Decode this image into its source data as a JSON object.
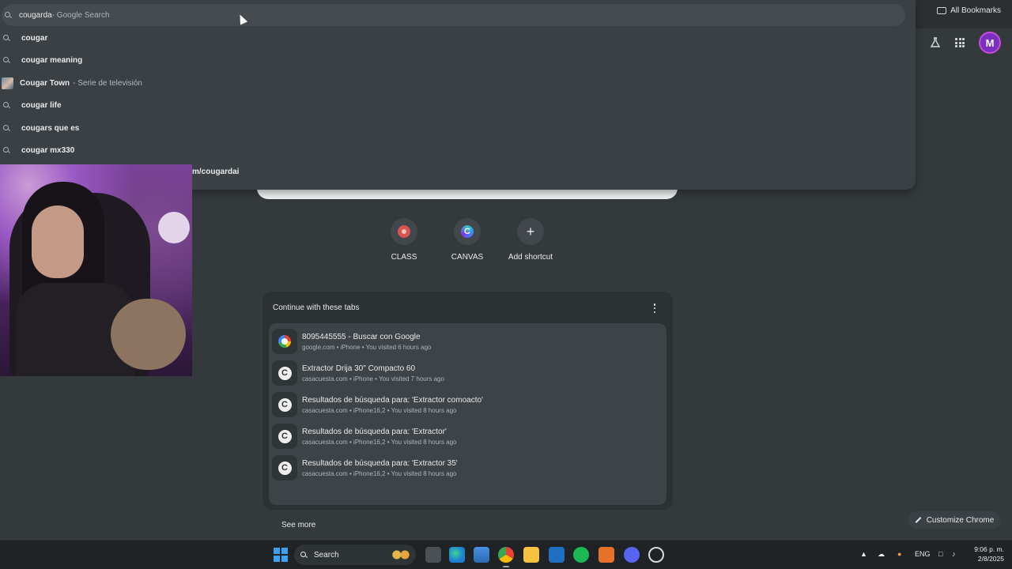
{
  "browser": {
    "all_bookmarks_label": "All Bookmarks",
    "profile_initial": "M",
    "accent_color": "#7b2fbe"
  },
  "omnibox": {
    "input_text": "cougarda",
    "inline_suggestion": " - Google Search",
    "suggestions": [
      {
        "text": "cougar",
        "sub": "",
        "icon": "search-icon"
      },
      {
        "text": "cougar meaning",
        "sub": "",
        "icon": "search-icon"
      },
      {
        "text": "Cougar Town",
        "sub": "- Serie de televisión",
        "icon": "entity-thumbnail"
      },
      {
        "text": "cougar life",
        "sub": "",
        "icon": "search-icon"
      },
      {
        "text": "cougars que es",
        "sub": "",
        "icon": "search-icon"
      },
      {
        "text": "cougar mx330",
        "sub": "",
        "icon": "search-icon"
      }
    ],
    "url_suggestion_visible": "m/cougardai"
  },
  "shortcuts": [
    {
      "label": "CLASS",
      "icon": "class-icon"
    },
    {
      "label": "CANVAS",
      "icon": "canvas-icon"
    },
    {
      "label": "Add shortcut",
      "icon": "plus-icon"
    }
  ],
  "continue_tabs": {
    "title": "Continue with these tabs",
    "items": [
      {
        "title": "8095445555 - Buscar con Google",
        "meta": "google.com • iPhone • You visited 6 hours ago",
        "icon": "google-icon"
      },
      {
        "title": "Extractor Drija 30\" Compacto 60",
        "meta": "casacuesta.com • iPhone • You visited 7 hours ago",
        "icon": "casacuesta-icon"
      },
      {
        "title": "Resultados de búsqueda para: 'Extractor comoacto'",
        "meta": "casacuesta.com • iPhone16,2 • You visited 8 hours ago",
        "icon": "casacuesta-icon"
      },
      {
        "title": "Resultados de búsqueda para: 'Extractor'",
        "meta": "casacuesta.com • iPhone16,2 • You visited 8 hours ago",
        "icon": "casacuesta-icon"
      },
      {
        "title": "Resultados de búsqueda para: 'Extractor 35'",
        "meta": "casacuesta.com • iPhone16,2 • You visited 8 hours ago",
        "icon": "casacuesta-icon"
      }
    ],
    "see_more": "See more"
  },
  "customize_label": "Customize Chrome",
  "taskbar": {
    "search_label": "Search",
    "language": "ENG",
    "time": "9:06 p. m.",
    "date": "2/8/2025",
    "apps": [
      "windows-start-icon",
      "task-view-icon",
      "edge-icon",
      "store-icon",
      "chrome-icon",
      "file-explorer-icon",
      "outlook-icon",
      "spotify-icon",
      "app-orange-icon",
      "discord-icon",
      "app-settings-icon"
    ]
  }
}
